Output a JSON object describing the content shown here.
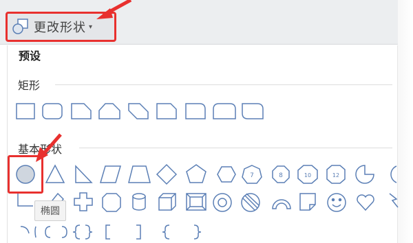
{
  "toolbar": {
    "change_shape_label": "更改形状",
    "caret": "▾"
  },
  "dropdown": {
    "presets_title": "预设",
    "sections": [
      {
        "label": "矩形"
      },
      {
        "label": "基本形状"
      }
    ],
    "tooltip": "椭圆",
    "octagon_numbers": [
      "7",
      "8",
      "10",
      "12"
    ]
  },
  "colors": {
    "shape_stroke": "#5b7fb5",
    "highlight": "#e8302e",
    "selected_fill": "#cfd6df"
  }
}
